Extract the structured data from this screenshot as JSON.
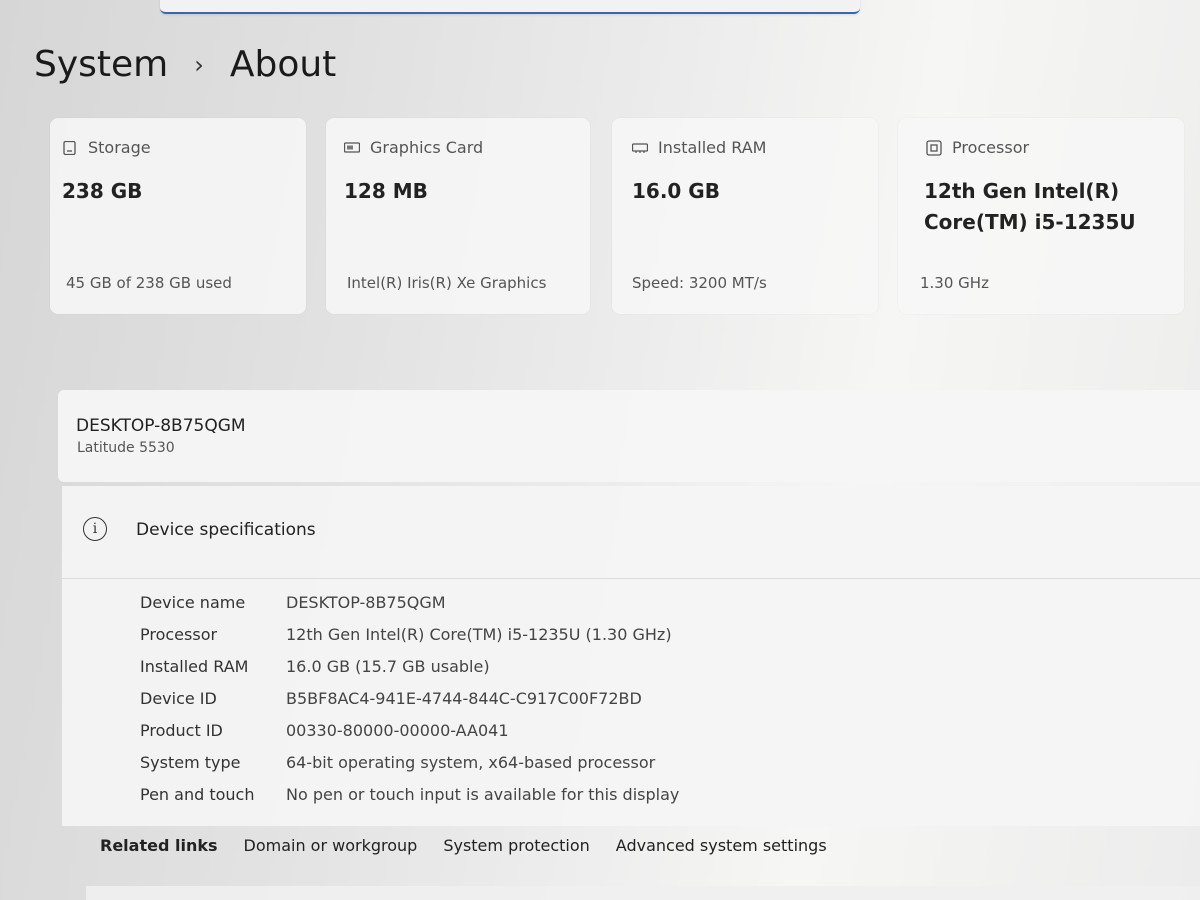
{
  "breadcrumb": {
    "section": "System",
    "separator": "›",
    "page": "About"
  },
  "cards": [
    {
      "title": "Storage",
      "icon": "storage-icon",
      "value": "238 GB",
      "sub": "45 GB of 238 GB used"
    },
    {
      "title": "Graphics Card",
      "icon": "graphics-card-icon",
      "value": "128 MB",
      "sub": "Intel(R) Iris(R) Xe Graphics"
    },
    {
      "title": "Installed RAM",
      "icon": "ram-icon",
      "value": "16.0 GB",
      "sub": "Speed: 3200 MT/s"
    },
    {
      "title": "Processor",
      "icon": "processor-icon",
      "value": "12th Gen Intel(R) Core(TM) i5-1235U",
      "sub": "1.30 GHz"
    }
  ],
  "device": {
    "name": "DESKTOP-8B75QGM",
    "model": "Latitude 5530"
  },
  "specs": {
    "title": "Device specifications",
    "info_glyph": "i",
    "rows": [
      {
        "key": "Device name",
        "value": "DESKTOP-8B75QGM"
      },
      {
        "key": "Processor",
        "value": "12th Gen Intel(R) Core(TM) i5-1235U (1.30 GHz)"
      },
      {
        "key": "Installed RAM",
        "value": "16.0 GB (15.7 GB usable)"
      },
      {
        "key": "Device ID",
        "value": "B5BF8AC4-941E-4744-844C-C917C00F72BD"
      },
      {
        "key": "Product ID",
        "value": "00330-80000-00000-AA041"
      },
      {
        "key": "System type",
        "value": "64-bit operating system, x64-based processor"
      },
      {
        "key": "Pen and touch",
        "value": "No pen or touch input is available for this display"
      }
    ]
  },
  "related": {
    "label": "Related links",
    "links": [
      "Domain or workgroup",
      "System protection",
      "Advanced system settings"
    ]
  },
  "colors": {
    "accent": "#3a66b3"
  }
}
